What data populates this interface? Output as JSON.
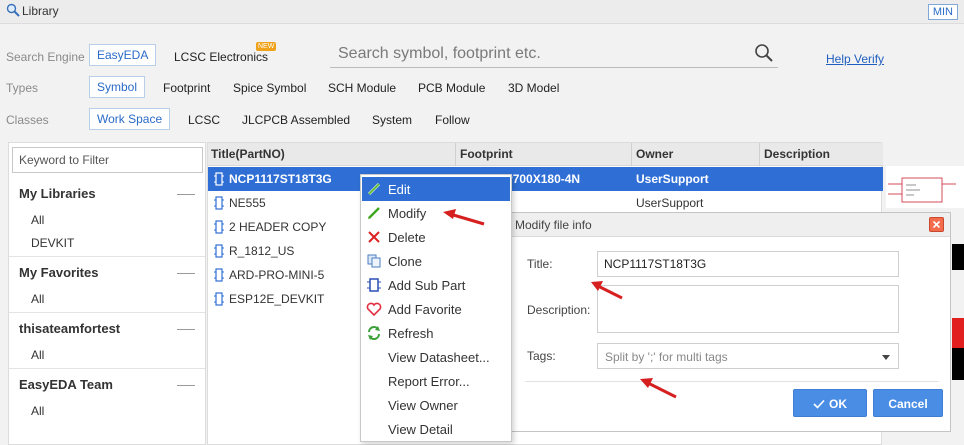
{
  "window": {
    "title": "Library",
    "min_label": "MIN"
  },
  "search_engine": {
    "label": "Search Engine",
    "options": [
      "EasyEDA",
      "LCSC Electronics"
    ],
    "selected": "EasyEDA",
    "new_badge": "NEW"
  },
  "types": {
    "label": "Types",
    "options": [
      "Symbol",
      "Footprint",
      "Spice Symbol",
      "SCH Module",
      "PCB Module",
      "3D Model"
    ],
    "selected": "Symbol"
  },
  "classes": {
    "label": "Classes",
    "options": [
      "Work Space",
      "LCSC",
      "JLCPCB Assembled",
      "System",
      "Follow"
    ],
    "selected": "Work Space"
  },
  "search": {
    "placeholder": "Search symbol, footprint etc.",
    "help_link": "Help Verify"
  },
  "sidebar": {
    "filter_placeholder": "Keyword to Filter",
    "groups": [
      {
        "title": "My Libraries",
        "items": [
          "All",
          "DEVKIT"
        ]
      },
      {
        "title": "My Favorites",
        "items": [
          "All"
        ]
      },
      {
        "title": "thisateamfortest",
        "items": [
          "All"
        ]
      },
      {
        "title": "EasyEDA Team",
        "items": [
          "All"
        ]
      }
    ]
  },
  "table": {
    "columns": [
      "Title(PartNO)",
      "Footprint",
      "Owner",
      "Description"
    ],
    "rows": [
      {
        "title": "NCP1117ST18T3G",
        "footprint": "SOT230P700X180-4N",
        "owner": "UserSupport",
        "description": ""
      },
      {
        "title": "NE555",
        "footprint": "",
        "owner": "UserSupport",
        "description": ""
      },
      {
        "title": "2 HEADER COPY",
        "footprint": "",
        "owner": "",
        "description": ""
      },
      {
        "title": "R_1812_US",
        "footprint": "",
        "owner": "",
        "description": ""
      },
      {
        "title": "ARD-PRO-MINI-5",
        "footprint": "",
        "owner": "",
        "description": ""
      },
      {
        "title": "ESP12E_DEVKIT",
        "footprint": "",
        "owner": "",
        "description": ""
      }
    ],
    "selected_row": 0
  },
  "context_menu": {
    "items": [
      {
        "label": "Edit",
        "icon": "pencil-icon"
      },
      {
        "label": "Modify",
        "icon": "pencil-icon"
      },
      {
        "label": "Delete",
        "icon": "x-icon"
      },
      {
        "label": "Clone",
        "icon": "copy-icon"
      },
      {
        "label": "Add Sub Part",
        "icon": "chip-icon"
      },
      {
        "label": "Add Favorite",
        "icon": "heart-icon"
      },
      {
        "label": "Refresh",
        "icon": "refresh-icon"
      },
      {
        "label": "View Datasheet...",
        "icon": ""
      },
      {
        "label": "Report Error...",
        "icon": ""
      },
      {
        "label": "View Owner",
        "icon": ""
      },
      {
        "label": "View Detail",
        "icon": ""
      }
    ],
    "active": 0
  },
  "dialog": {
    "title": "Modify file info",
    "title_label": "Title:",
    "title_value": "NCP1117ST18T3G",
    "description_label": "Description:",
    "description_value": "",
    "tags_label": "Tags:",
    "tags_placeholder": "Split by ';' for multi tags",
    "ok_label": "OK",
    "cancel_label": "Cancel"
  },
  "colors": {
    "accent": "#2f6fd5",
    "link": "#1f5fbf",
    "button": "#4a8de4",
    "annotation_arrow": "#d61f1f"
  }
}
